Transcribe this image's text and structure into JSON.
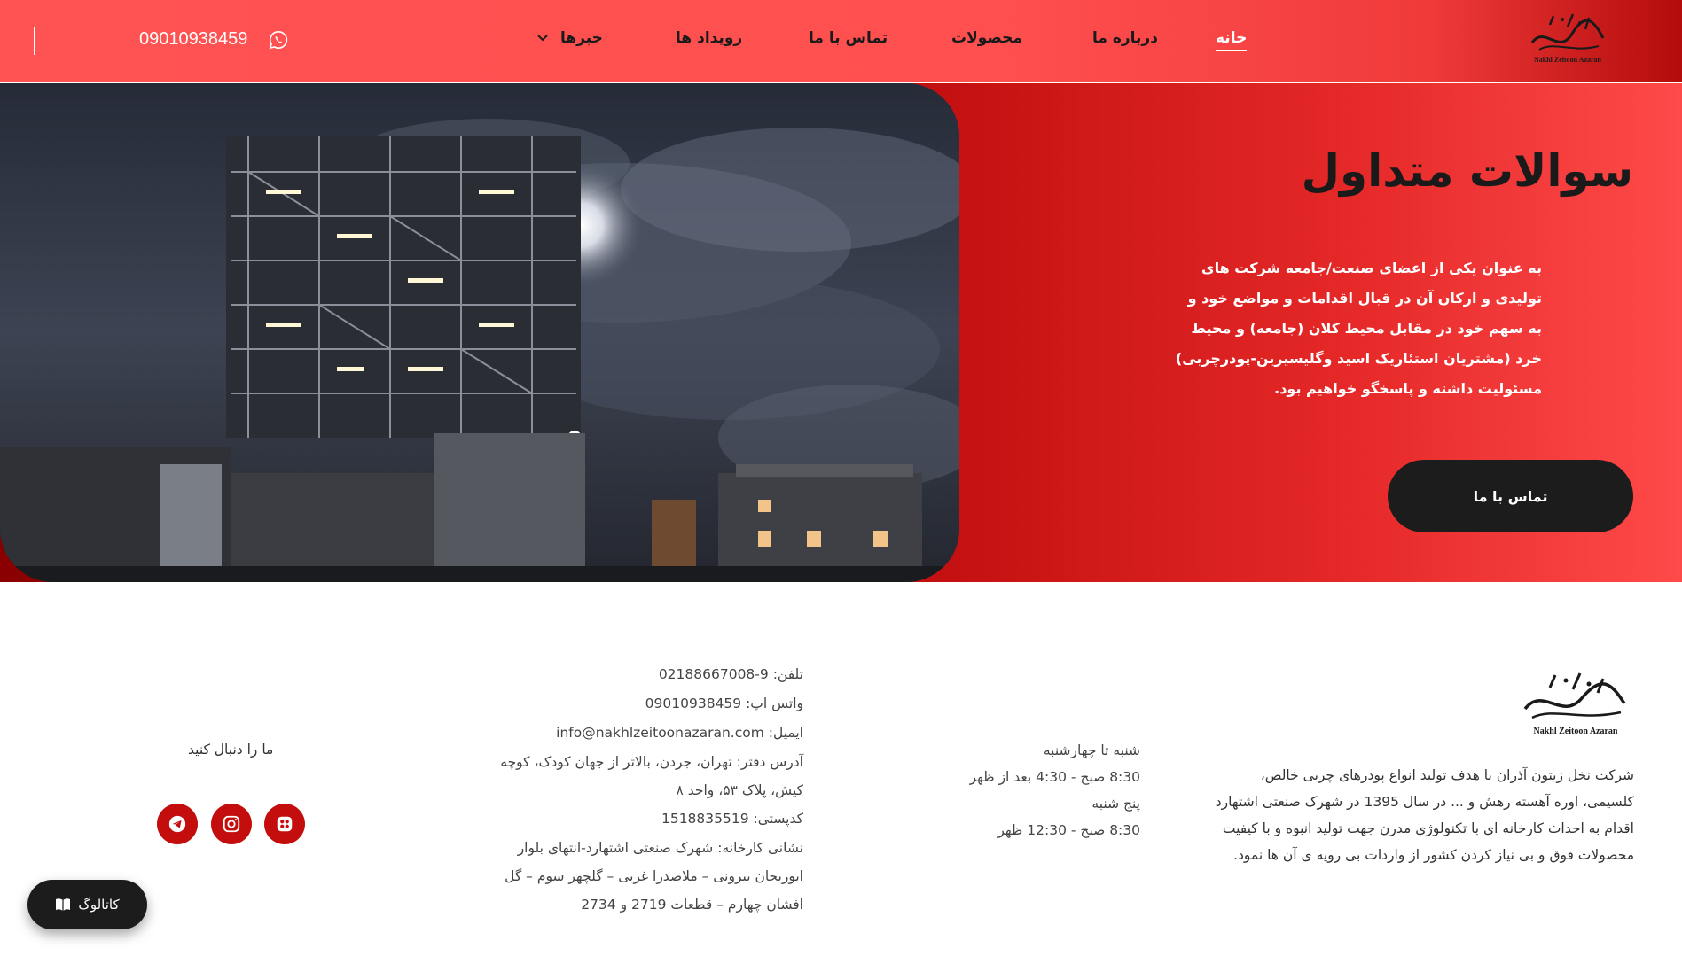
{
  "header": {
    "logo_alt": "نخل زیتون آذران",
    "nav": [
      {
        "label": "خانه"
      },
      {
        "label": "درباره ما"
      },
      {
        "label": "محصولات"
      },
      {
        "label": "تماس با ما"
      },
      {
        "label": "رویداد ها"
      },
      {
        "label": "خبرها"
      }
    ],
    "phone": "09010938459"
  },
  "hero": {
    "title": "سوالات متداول",
    "text": "به عنوان یکی از اعضای صنعت/جامعه شرکت های تولیدی و ارکان آن در قبال اقدامات و مواضع خود و به سهم خود در مقابل محیط کلان (جامعه) و محیط خرد (مشتریان استئاریک اسید وگلیسیرین-پودرچربی) مسئولیت داشته و پاسخگو خواهیم بود.",
    "button": "تماس با ما"
  },
  "footer": {
    "logo_caption": "Nakhl Zeitoon Azaran",
    "about": "شرکت نخل زیتون آذران با هدف تولید انواع پودرهای چربی خالص، کلسیمی، اوره آهسته رهش و ... در سال 1395 در شهرک صنعتی اشتهارد اقدام به احداث کارخانه ای با تکنولوژی مدرن جهت تولید انبوه و با کیفیت محصولات فوق و بی نیاز کردن کشور از واردات بی رویه ی آن ها نمود.",
    "hours": [
      "شنبه تا چهارشنبه",
      "8:30 صبح - 4:30 بعد از ظهر",
      "پنج شنبه",
      "8:30 صبح - 12:30 ظهر"
    ],
    "contact": {
      "phone": "تلفن: 9-02188667008",
      "whatsapp": "واتس اپ: 09010938459",
      "email": "ایمیل: info@nakhlzeitoonazaran.com",
      "office": "آدرس دفتر: تهران، جردن، بالاتر از جهان کودک، کوچه کیش، پلاک ۵۳، واحد ۸",
      "postal": "کدپستی: 1518835519",
      "factory": "نشانی کارخانه: شهرک صنعتی اشتهارد-انتهای بلوار ابوریحان بیرونی – ملاصدرا غربی – گلچهر سوم – گل افشان چهارم – قطعات 2719 و 2734"
    },
    "follow": "ما را دنبال کنید",
    "catalog": "کاتالوگ"
  },
  "colors": {
    "header_red": "#ff5252",
    "hero_dark_red": "#8a0000",
    "button_dark": "#1c1c1c",
    "social_red": "#c40d0d"
  },
  "icons": [
    "whatsapp-icon",
    "chevron-down-icon",
    "telegram-icon",
    "instagram-icon",
    "aparat-icon",
    "book-icon"
  ]
}
